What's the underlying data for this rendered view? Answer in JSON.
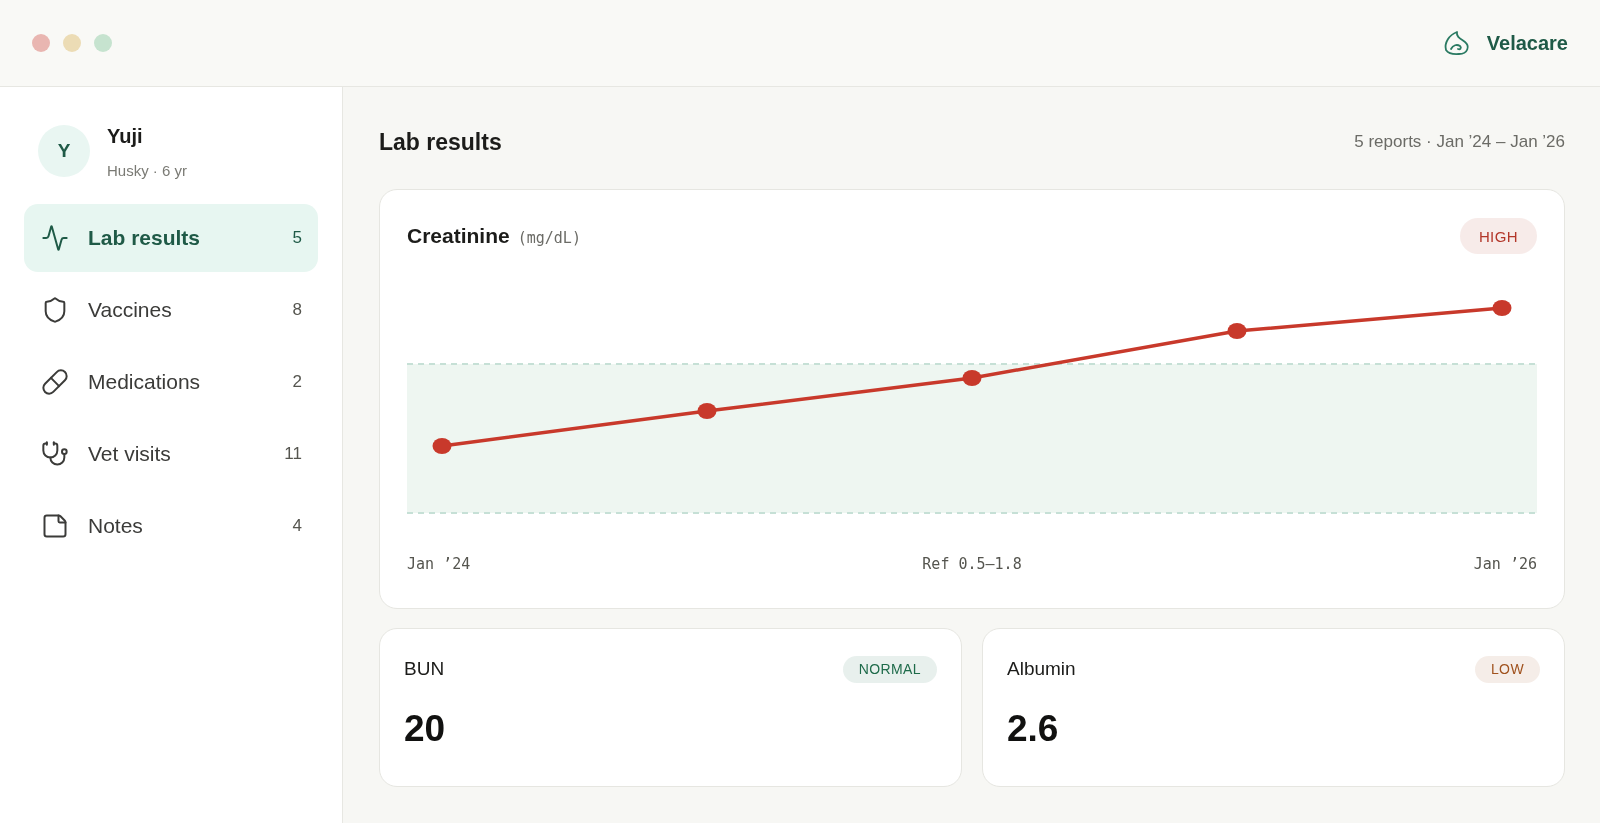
{
  "window": {
    "brand": "Velacare"
  },
  "profile": {
    "initial": "Y",
    "name": "Yuji",
    "details": "Husky · 6 yr"
  },
  "sidebar": {
    "items": [
      {
        "label": "Lab results",
        "count": "5",
        "selected": true
      },
      {
        "label": "Vaccines",
        "count": "8",
        "selected": false
      },
      {
        "label": "Medications",
        "count": "2",
        "selected": false
      },
      {
        "label": "Vet visits",
        "count": "11",
        "selected": false
      },
      {
        "label": "Notes",
        "count": "4",
        "selected": false
      }
    ]
  },
  "main": {
    "title": "Lab results",
    "summary": "5 reports · Jan ’24 – Jan ’26",
    "results": [
      {
        "kind": "chart",
        "name": "Creatinine",
        "unit": "(mg/dL)",
        "status": "HIGH",
        "color": "#b3372a",
        "trend": {
          "start_label": "Jan ’24",
          "reference_range": "Ref 0.5–1.8",
          "end_label": "Jan ’26"
        }
      },
      {
        "kind": "tile",
        "name": "BUN",
        "value": "20",
        "status": "NORMAL",
        "color": "#1e6b4a"
      },
      {
        "kind": "tile",
        "name": "Albumin",
        "value": "2.6",
        "status": "LOW",
        "color": "#a0521e"
      }
    ]
  }
}
